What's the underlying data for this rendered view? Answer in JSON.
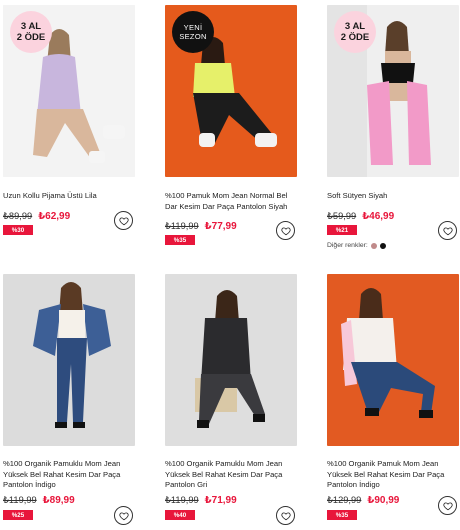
{
  "products": [
    {
      "badge": {
        "line1": "3 AL",
        "line2": "2 ÖDE",
        "style": "pink"
      },
      "title": "Uzun Kollu Pijama Üstü Lila",
      "old_price": "₺89,99",
      "new_price": "₺62,99",
      "discount": "%30",
      "photo_bg": "#ececec",
      "outfit": "#c8b6dd"
    },
    {
      "badge": {
        "line1": "YENİ",
        "line2": "SEZON",
        "style": "black"
      },
      "title": "%100 Pamuk Mom Jean Normal Bel Dar Kesim Dar Paça Pantolon Siyah",
      "old_price": "₺119,99",
      "new_price": "₺77,99",
      "discount": "%35",
      "photo_bg": "#e55a1c",
      "outfit": "#1c1c1c"
    },
    {
      "badge": {
        "line1": "3 AL",
        "line2": "2 ÖDE",
        "style": "pink"
      },
      "title": "Soft Sütyen Siyah",
      "old_price": "₺59,99",
      "new_price": "₺46,99",
      "discount": "%21",
      "photo_bg": "#efefef",
      "outfit": "#f29ac8",
      "other_colors_label": "Diğer renkler:",
      "other_colors": [
        "#c08a8a",
        "#111111"
      ]
    },
    {
      "title": "%100 Organik Pamuklu Mom Jean Yüksek Bel Rahat Kesim Dar Paça Pantolon İndigo",
      "old_price": "₺119,99",
      "new_price": "₺89,99",
      "discount": "%25",
      "photo_bg": "#dcdcdc",
      "outfit": "#2e4c7e"
    },
    {
      "title": "%100 Organik Pamuklu Mom Jean Yüksek Bel Rahat Kesim Dar Paça Pantolon Gri",
      "old_price": "₺119,99",
      "new_price": "₺71,99",
      "discount": "%40",
      "photo_bg": "#dedede",
      "outfit": "#3a3a3e"
    },
    {
      "title": "%100 Organik Pamuk Mom Jean Yüksek Bel Rahat Kesim Dar Paça Pantolon İndigo",
      "old_price": "₺129,99",
      "new_price": "₺90,99",
      "discount": "%35",
      "photo_bg": "#e25a22",
      "outfit": "#2b4a7a"
    }
  ],
  "icons": {
    "favorite": "heart-outline-icon"
  },
  "colors": {
    "price_red": "#e8163b",
    "badge_pink": "#fbd3de"
  }
}
